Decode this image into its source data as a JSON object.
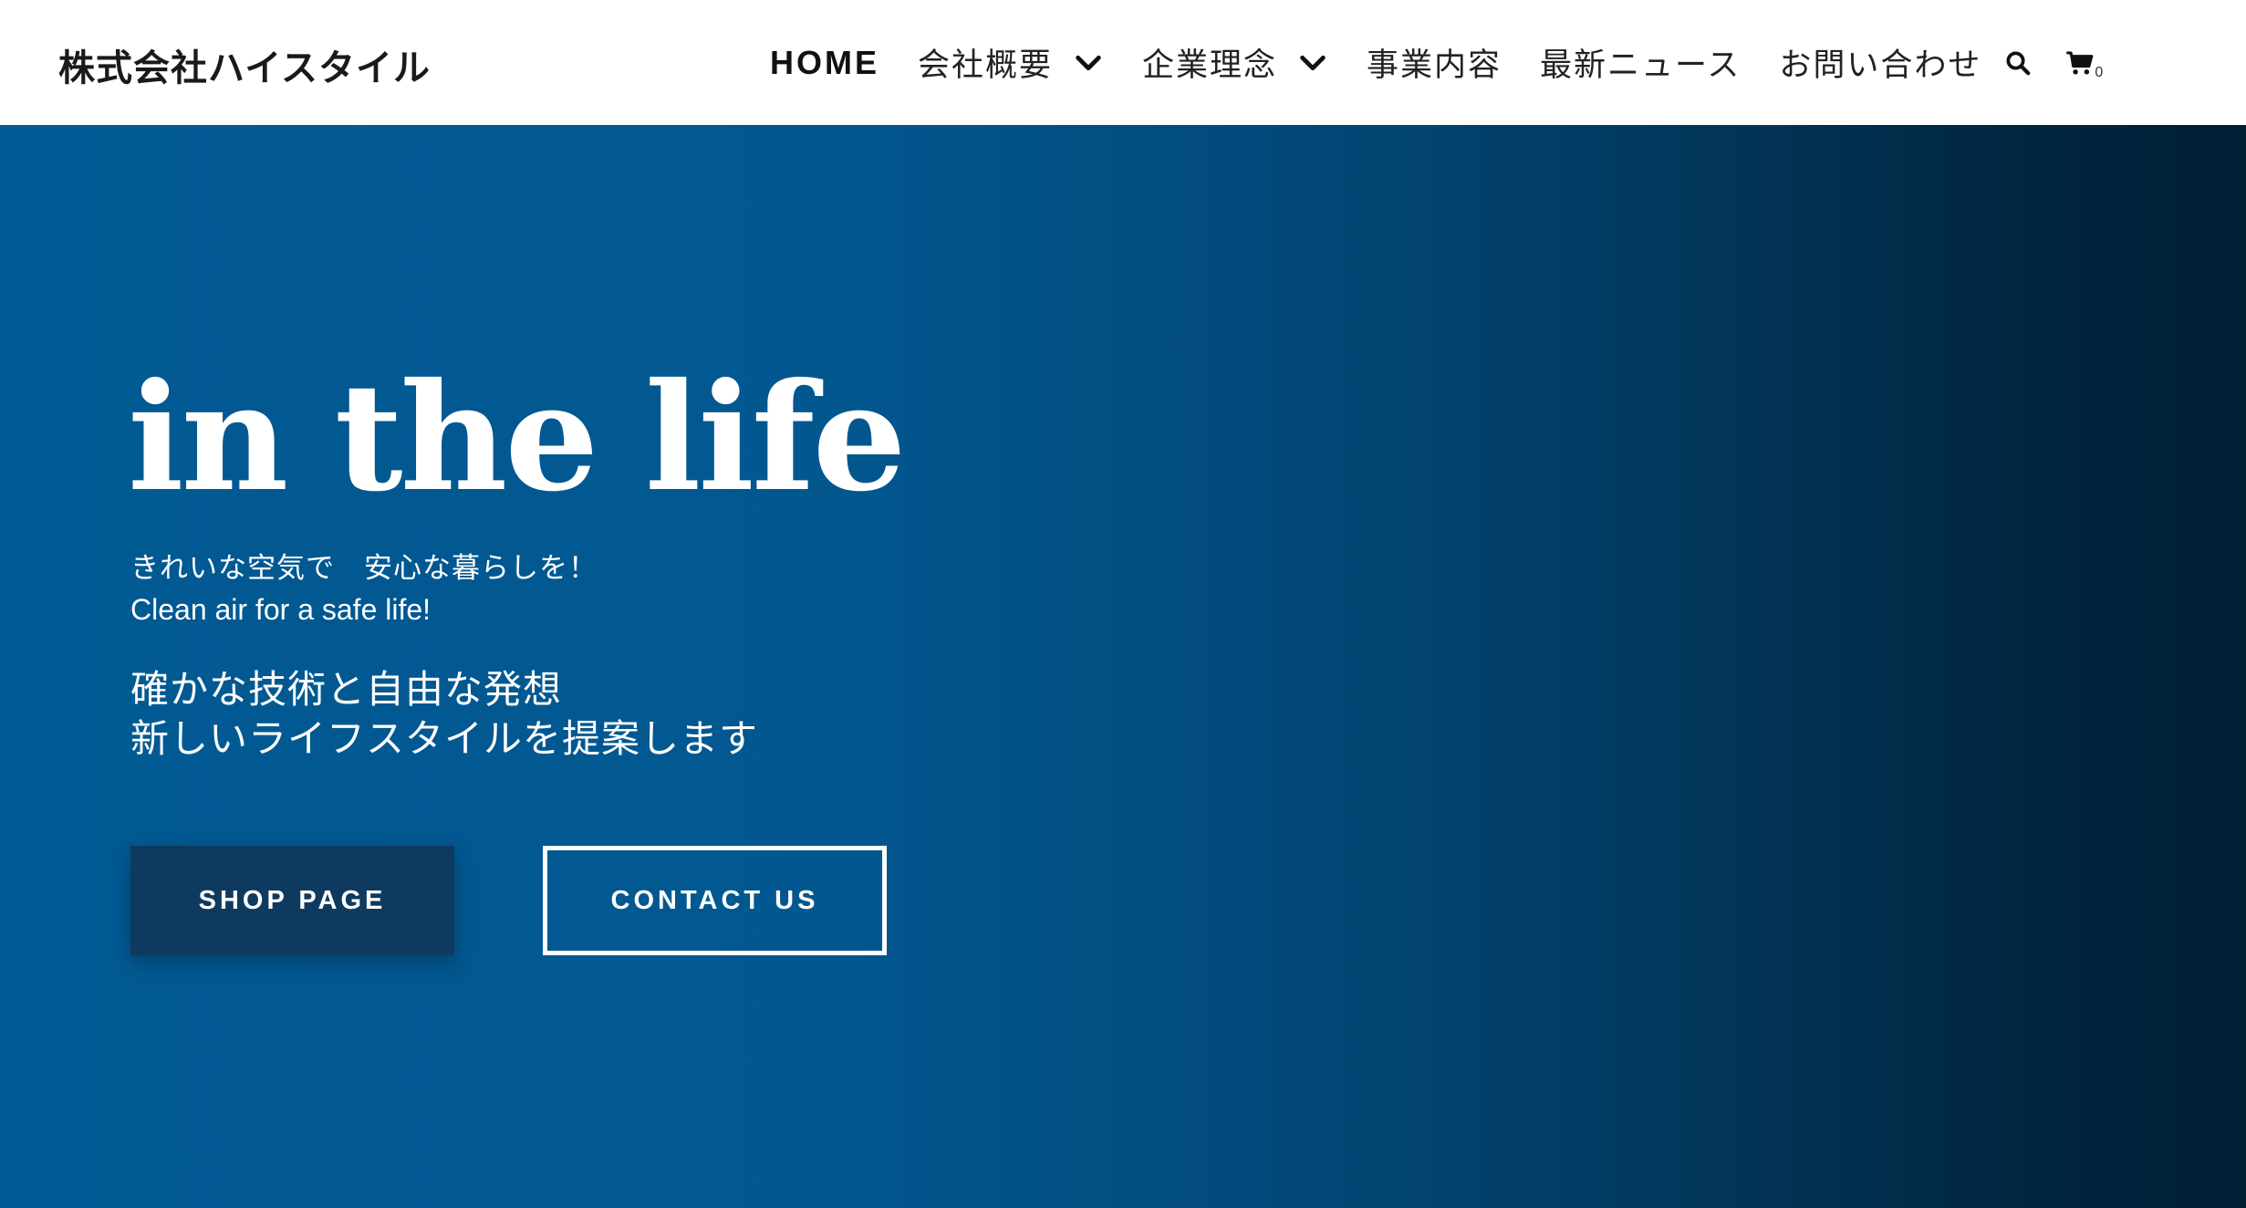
{
  "header": {
    "logo": "株式会社ハイスタイル",
    "nav": {
      "home": "HOME",
      "company": "会社概要",
      "philosophy": "企業理念",
      "business": "事業内容",
      "news": "最新ニュース",
      "contact": "お問い合わせ"
    },
    "cart_count": "0"
  },
  "hero": {
    "title": "in the life",
    "sub_ja": "きれいな空気で　安心な暮らしを！",
    "sub_en": "Clean air for a safe life!",
    "desc_line1": "確かな技術と自由な発想",
    "desc_line2": "新しいライフスタイルを提案します",
    "shop_button": "SHOP PAGE",
    "contact_button": "CONTACT US"
  },
  "icons": {
    "dropdown": "chevron-down-icon",
    "search": "search-icon",
    "cart": "cart-icon"
  },
  "colors": {
    "hero_start": "#025a94",
    "hero_end": "#011e33",
    "shop_button_bg": "#0f3a5f",
    "header_bg": "#ffffff",
    "text_dark": "#222222"
  }
}
